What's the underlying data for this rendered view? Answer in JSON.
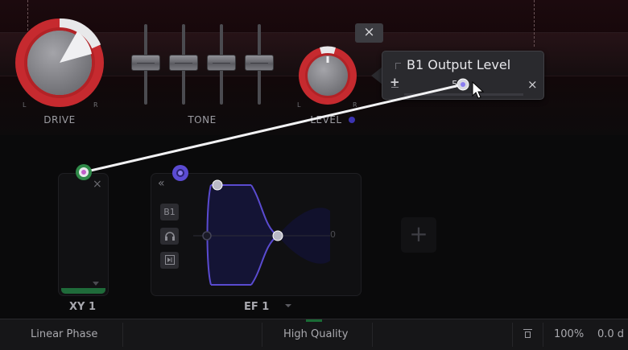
{
  "top_panel": {
    "drive": {
      "label": "DRIVE",
      "left": "L",
      "right": "R",
      "value_fraction": 0.9
    },
    "tone": {
      "label": "TONE",
      "slider_count": 4
    },
    "level": {
      "label": "LEVEL",
      "left": "L",
      "right": "R",
      "value_fraction": 0.5
    },
    "close_label": "×"
  },
  "tooltip": {
    "title": "B1 Output Level",
    "plus": "+",
    "value": "50",
    "close": "×"
  },
  "xy_panel": {
    "label": "XY 1",
    "close": "×"
  },
  "ef_panel": {
    "label": "EF 1",
    "collapse": "«",
    "b1_button": "B1",
    "zero_label": "0"
  },
  "add_button": "+",
  "statusbar": {
    "linear_phase": "Linear Phase",
    "high_quality": "High Quality",
    "zoom": "100%",
    "db_value": "0.0 d"
  },
  "colors": {
    "knob_ring": "#c62a2f",
    "knob_body": "#8a8a8f",
    "connection_node": "#2f8a48",
    "modulation_node": "#5b4bd2",
    "curve": "#4e40c2",
    "status_led": "#1a6b35"
  }
}
